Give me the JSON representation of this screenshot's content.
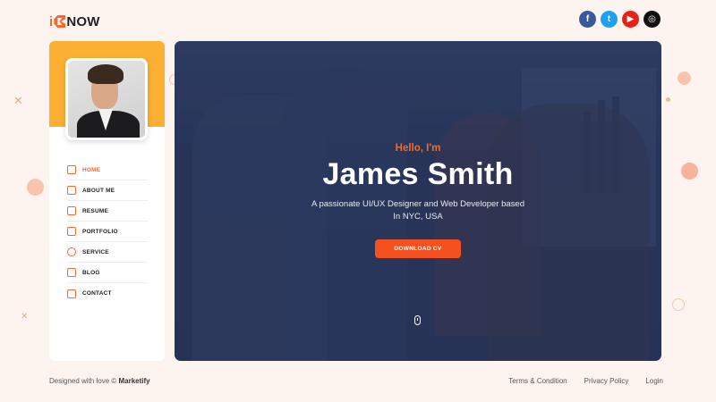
{
  "brand": {
    "logo_prefix": "i",
    "logo_text": "NOW"
  },
  "socials": [
    {
      "icon": "facebook-icon",
      "glyph": "f"
    },
    {
      "icon": "twitter-icon",
      "glyph": "t"
    },
    {
      "icon": "youtube-icon",
      "glyph": "▶"
    },
    {
      "icon": "instagram-icon",
      "glyph": "◎"
    }
  ],
  "sidebar": {
    "items": [
      {
        "label": "HOME",
        "icon": "home-icon",
        "active": true
      },
      {
        "label": "ABOUT ME",
        "icon": "user-icon",
        "active": false
      },
      {
        "label": "RESUME",
        "icon": "resume-icon",
        "active": false
      },
      {
        "label": "PORTFOLIO",
        "icon": "briefcase-icon",
        "active": false
      },
      {
        "label": "SERVICE",
        "icon": "gear-icon",
        "active": false
      },
      {
        "label": "BLOG",
        "icon": "blog-icon",
        "active": false
      },
      {
        "label": "CONTACT",
        "icon": "mail-icon",
        "active": false
      }
    ]
  },
  "hero": {
    "greeting": "Hello, I'm",
    "name": "James Smith",
    "tagline": "A passionate UI/UX Designer and Web Developer based In NYC, USA",
    "cta_label": "DOWNLOAD CV"
  },
  "footer": {
    "credit_prefix": "Designed with love ©",
    "credit_brand": "Marketify",
    "links": [
      "Terms & Condition",
      "Privacy Policy",
      "Login"
    ]
  },
  "colors": {
    "accent": "#f26a2e",
    "sidebar_band": "#fbb034",
    "page_bg": "#fdf4f0",
    "hero_overlay": "#2c3a5c"
  }
}
